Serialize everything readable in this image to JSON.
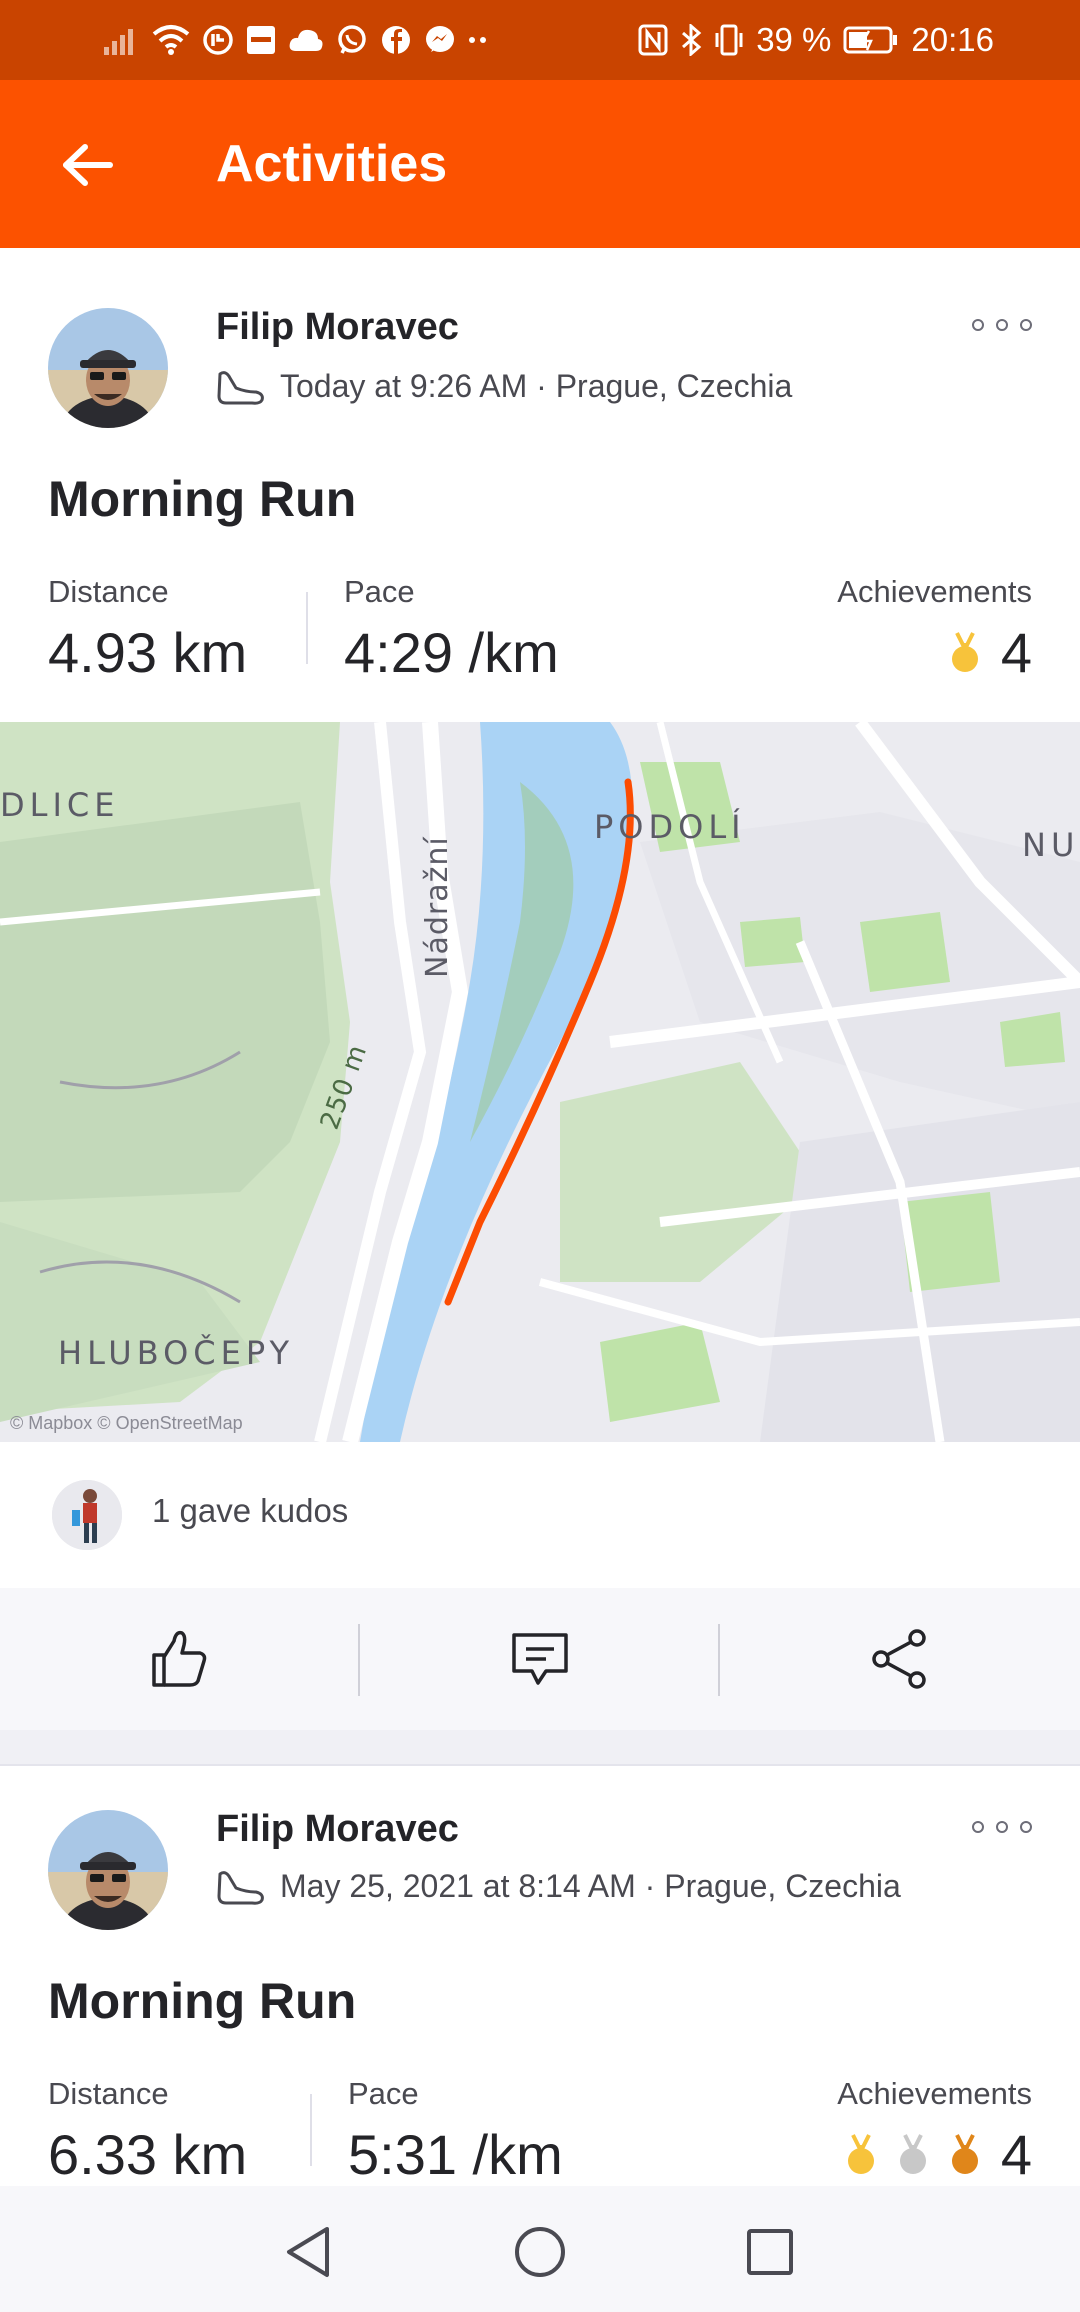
{
  "status_bar": {
    "battery_percent": "39 %",
    "time": "20:16",
    "icons": [
      "signal-icon",
      "wifi-icon",
      "app-notification-icon",
      "sonos-icon",
      "cloud-icon",
      "whatsapp-icon",
      "facebook-icon",
      "messenger-icon",
      "more-notifications-icon",
      "nfc-icon",
      "bluetooth-icon",
      "vibrate-icon",
      "battery-icon"
    ]
  },
  "app_bar": {
    "title": "Activities",
    "back_icon": "arrow-left-icon"
  },
  "colors": {
    "brand": "#fc5200",
    "status_bar": "#c94400",
    "route": "#fc4c02",
    "gold": "#f7c33b",
    "silver": "#c8c8c8",
    "bronze": "#e0861a"
  },
  "activities": [
    {
      "athlete": "Filip Moravec",
      "date_location": "Today at 9:26 AM · Prague, Czechia",
      "sport_icon": "shoe-icon",
      "title": "Morning Run",
      "stats": {
        "distance_label": "Distance",
        "distance_value": "4.93 km",
        "pace_label": "Pace",
        "pace_value": "4:29 /km",
        "achievements_label": "Achievements",
        "achievements_value": "4",
        "medals": [
          "gold"
        ]
      },
      "map": {
        "labels": [
          "DLICE",
          "PODOLÍ",
          "NU",
          "Nádražní",
          "250 m",
          "HLUBOČEPY"
        ],
        "attribution": "© Mapbox © OpenStreetMap"
      },
      "kudos_text": "1 gave kudos",
      "actions": [
        "kudos-icon",
        "comment-icon",
        "share-icon"
      ]
    },
    {
      "athlete": "Filip Moravec",
      "date_location": "May 25, 2021 at 8:14 AM · Prague, Czechia",
      "sport_icon": "shoe-icon",
      "title": "Morning Run",
      "stats": {
        "distance_label": "Distance",
        "distance_value": "6.33 km",
        "pace_label": "Pace",
        "pace_value": "5:31 /km",
        "achievements_label": "Achievements",
        "achievements_value": "4",
        "medals": [
          "gold",
          "silver",
          "bronze"
        ]
      }
    }
  ],
  "nav_bar": {
    "buttons": [
      "back-triangle-icon",
      "home-circle-icon",
      "recents-square-icon"
    ]
  }
}
